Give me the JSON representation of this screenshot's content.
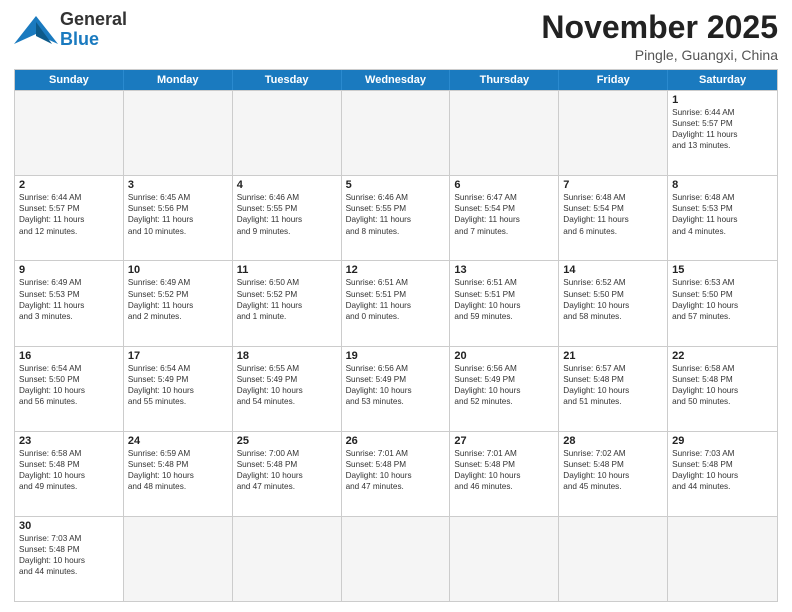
{
  "header": {
    "logo_general": "General",
    "logo_blue": "Blue",
    "month_title": "November 2025",
    "location": "Pingle, Guangxi, China"
  },
  "weekdays": [
    "Sunday",
    "Monday",
    "Tuesday",
    "Wednesday",
    "Thursday",
    "Friday",
    "Saturday"
  ],
  "rows": [
    [
      {
        "day": "",
        "info": ""
      },
      {
        "day": "",
        "info": ""
      },
      {
        "day": "",
        "info": ""
      },
      {
        "day": "",
        "info": ""
      },
      {
        "day": "",
        "info": ""
      },
      {
        "day": "",
        "info": ""
      },
      {
        "day": "1",
        "info": "Sunrise: 6:44 AM\nSunset: 5:57 PM\nDaylight: 11 hours\nand 13 minutes."
      }
    ],
    [
      {
        "day": "2",
        "info": "Sunrise: 6:44 AM\nSunset: 5:57 PM\nDaylight: 11 hours\nand 12 minutes."
      },
      {
        "day": "3",
        "info": "Sunrise: 6:45 AM\nSunset: 5:56 PM\nDaylight: 11 hours\nand 10 minutes."
      },
      {
        "day": "4",
        "info": "Sunrise: 6:46 AM\nSunset: 5:55 PM\nDaylight: 11 hours\nand 9 minutes."
      },
      {
        "day": "5",
        "info": "Sunrise: 6:46 AM\nSunset: 5:55 PM\nDaylight: 11 hours\nand 8 minutes."
      },
      {
        "day": "6",
        "info": "Sunrise: 6:47 AM\nSunset: 5:54 PM\nDaylight: 11 hours\nand 7 minutes."
      },
      {
        "day": "7",
        "info": "Sunrise: 6:48 AM\nSunset: 5:54 PM\nDaylight: 11 hours\nand 6 minutes."
      },
      {
        "day": "8",
        "info": "Sunrise: 6:48 AM\nSunset: 5:53 PM\nDaylight: 11 hours\nand 4 minutes."
      }
    ],
    [
      {
        "day": "9",
        "info": "Sunrise: 6:49 AM\nSunset: 5:53 PM\nDaylight: 11 hours\nand 3 minutes."
      },
      {
        "day": "10",
        "info": "Sunrise: 6:49 AM\nSunset: 5:52 PM\nDaylight: 11 hours\nand 2 minutes."
      },
      {
        "day": "11",
        "info": "Sunrise: 6:50 AM\nSunset: 5:52 PM\nDaylight: 11 hours\nand 1 minute."
      },
      {
        "day": "12",
        "info": "Sunrise: 6:51 AM\nSunset: 5:51 PM\nDaylight: 11 hours\nand 0 minutes."
      },
      {
        "day": "13",
        "info": "Sunrise: 6:51 AM\nSunset: 5:51 PM\nDaylight: 10 hours\nand 59 minutes."
      },
      {
        "day": "14",
        "info": "Sunrise: 6:52 AM\nSunset: 5:50 PM\nDaylight: 10 hours\nand 58 minutes."
      },
      {
        "day": "15",
        "info": "Sunrise: 6:53 AM\nSunset: 5:50 PM\nDaylight: 10 hours\nand 57 minutes."
      }
    ],
    [
      {
        "day": "16",
        "info": "Sunrise: 6:54 AM\nSunset: 5:50 PM\nDaylight: 10 hours\nand 56 minutes."
      },
      {
        "day": "17",
        "info": "Sunrise: 6:54 AM\nSunset: 5:49 PM\nDaylight: 10 hours\nand 55 minutes."
      },
      {
        "day": "18",
        "info": "Sunrise: 6:55 AM\nSunset: 5:49 PM\nDaylight: 10 hours\nand 54 minutes."
      },
      {
        "day": "19",
        "info": "Sunrise: 6:56 AM\nSunset: 5:49 PM\nDaylight: 10 hours\nand 53 minutes."
      },
      {
        "day": "20",
        "info": "Sunrise: 6:56 AM\nSunset: 5:49 PM\nDaylight: 10 hours\nand 52 minutes."
      },
      {
        "day": "21",
        "info": "Sunrise: 6:57 AM\nSunset: 5:48 PM\nDaylight: 10 hours\nand 51 minutes."
      },
      {
        "day": "22",
        "info": "Sunrise: 6:58 AM\nSunset: 5:48 PM\nDaylight: 10 hours\nand 50 minutes."
      }
    ],
    [
      {
        "day": "23",
        "info": "Sunrise: 6:58 AM\nSunset: 5:48 PM\nDaylight: 10 hours\nand 49 minutes."
      },
      {
        "day": "24",
        "info": "Sunrise: 6:59 AM\nSunset: 5:48 PM\nDaylight: 10 hours\nand 48 minutes."
      },
      {
        "day": "25",
        "info": "Sunrise: 7:00 AM\nSunset: 5:48 PM\nDaylight: 10 hours\nand 47 minutes."
      },
      {
        "day": "26",
        "info": "Sunrise: 7:01 AM\nSunset: 5:48 PM\nDaylight: 10 hours\nand 47 minutes."
      },
      {
        "day": "27",
        "info": "Sunrise: 7:01 AM\nSunset: 5:48 PM\nDaylight: 10 hours\nand 46 minutes."
      },
      {
        "day": "28",
        "info": "Sunrise: 7:02 AM\nSunset: 5:48 PM\nDaylight: 10 hours\nand 45 minutes."
      },
      {
        "day": "29",
        "info": "Sunrise: 7:03 AM\nSunset: 5:48 PM\nDaylight: 10 hours\nand 44 minutes."
      }
    ],
    [
      {
        "day": "30",
        "info": "Sunrise: 7:03 AM\nSunset: 5:48 PM\nDaylight: 10 hours\nand 44 minutes."
      },
      {
        "day": "",
        "info": ""
      },
      {
        "day": "",
        "info": ""
      },
      {
        "day": "",
        "info": ""
      },
      {
        "day": "",
        "info": ""
      },
      {
        "day": "",
        "info": ""
      },
      {
        "day": "",
        "info": ""
      }
    ]
  ]
}
